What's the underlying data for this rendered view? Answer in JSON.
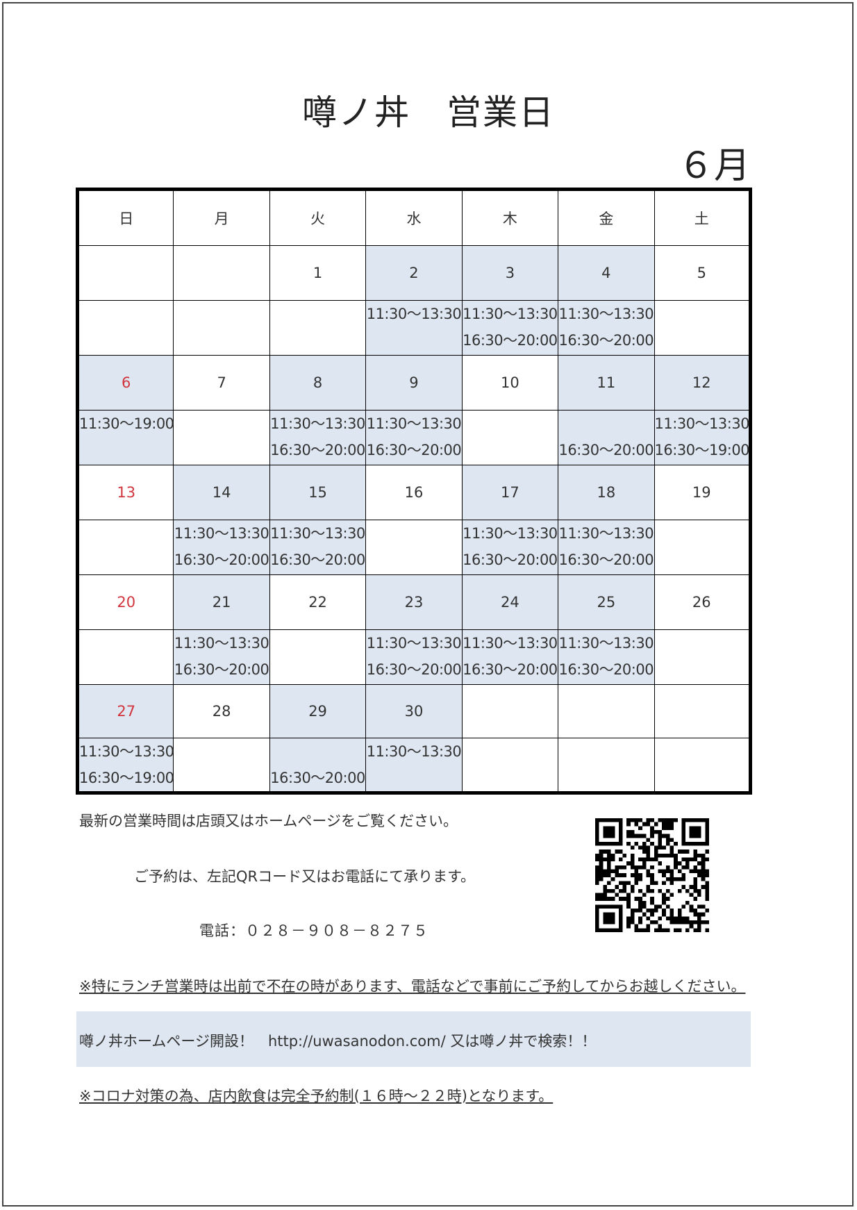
{
  "title": "噂ノ丼　営業日",
  "month": "６月",
  "weekdays": [
    "日",
    "月",
    "火",
    "水",
    "木",
    "金",
    "土"
  ],
  "weeks": [
    {
      "days": [
        {
          "date": "",
          "hours": []
        },
        {
          "date": "",
          "hours": []
        },
        {
          "date": "1",
          "hours": []
        },
        {
          "date": "2",
          "open": true,
          "hours": [
            "11:30～13:30"
          ]
        },
        {
          "date": "3",
          "open": true,
          "hours": [
            "11:30～13:30",
            "16:30～20:00"
          ]
        },
        {
          "date": "4",
          "open": true,
          "hours": [
            "11:30～13:30",
            "16:30～20:00"
          ]
        },
        {
          "date": "5",
          "hours": []
        }
      ]
    },
    {
      "days": [
        {
          "date": "6",
          "open": true,
          "holiday": true,
          "hours": [
            "11:30～19:00"
          ]
        },
        {
          "date": "7",
          "hours": []
        },
        {
          "date": "8",
          "open": true,
          "hours": [
            "11:30～13:30",
            "16:30～20:00"
          ]
        },
        {
          "date": "9",
          "open": true,
          "hours": [
            "11:30～13:30",
            "16:30～20:00"
          ]
        },
        {
          "date": "10",
          "hours": []
        },
        {
          "date": "11",
          "open": true,
          "hours": [
            "",
            "16:30～20:00"
          ]
        },
        {
          "date": "12",
          "open": true,
          "hours": [
            "11:30～13:30",
            "16:30～19:00"
          ]
        }
      ]
    },
    {
      "days": [
        {
          "date": "13",
          "holiday": true,
          "hours": []
        },
        {
          "date": "14",
          "open": true,
          "hours": [
            "11:30～13:30",
            "16:30～20:00"
          ]
        },
        {
          "date": "15",
          "open": true,
          "hours": [
            "11:30～13:30",
            "16:30～20:00"
          ]
        },
        {
          "date": "16",
          "hours": []
        },
        {
          "date": "17",
          "open": true,
          "hours": [
            "11:30～13:30",
            "16:30～20:00"
          ]
        },
        {
          "date": "18",
          "open": true,
          "hours": [
            "11:30～13:30",
            "16:30～20:00"
          ]
        },
        {
          "date": "19",
          "hours": []
        }
      ]
    },
    {
      "days": [
        {
          "date": "20",
          "holiday": true,
          "hours": []
        },
        {
          "date": "21",
          "open": true,
          "hours": [
            "11:30～13:30",
            "16:30～20:00"
          ]
        },
        {
          "date": "22",
          "hours": []
        },
        {
          "date": "23",
          "open": true,
          "hours": [
            "11:30～13:30",
            "16:30～20:00"
          ]
        },
        {
          "date": "24",
          "open": true,
          "hours": [
            "11:30～13:30",
            "16:30～20:00"
          ]
        },
        {
          "date": "25",
          "open": true,
          "hours": [
            "11:30～13:30",
            "16:30～20:00"
          ]
        },
        {
          "date": "26",
          "hours": []
        }
      ]
    },
    {
      "days": [
        {
          "date": "27",
          "open": true,
          "holiday": true,
          "hours": [
            "11:30～13:30",
            "16:30～19:00"
          ]
        },
        {
          "date": "28",
          "hours": []
        },
        {
          "date": "29",
          "open": true,
          "hours": [
            "",
            "16:30～20:00"
          ]
        },
        {
          "date": "30",
          "open": true,
          "hours": [
            "11:30～13:30"
          ]
        },
        {
          "date": "",
          "hours": []
        },
        {
          "date": "",
          "hours": []
        },
        {
          "date": "",
          "hours": []
        }
      ]
    }
  ],
  "notes": {
    "latest": "最新の営業時間は店頭又はホームページをご覧ください。",
    "reserve": "ご予約は、左記QRコード又はお電話にて承ります。",
    "phone": "電話：０２８－９０８－８２７５",
    "lunch": "※特にランチ営業時は出前で不在の時があります、電話などで事前にご予約してからお越しください。",
    "homepage": "噂ノ丼ホームページ開設！　http://uwasanodon.com/ 又は噂ノ丼で検索！！",
    "corona": "※コロナ対策の為、店内飲食は完全予約制(１６時～２２時)となります。"
  },
  "colors": {
    "open_day_fill": "#dde6f1",
    "sunday_text": "#d1343c",
    "banner_fill": "#dde6f1"
  },
  "qr_icon": "qr-code-icon"
}
